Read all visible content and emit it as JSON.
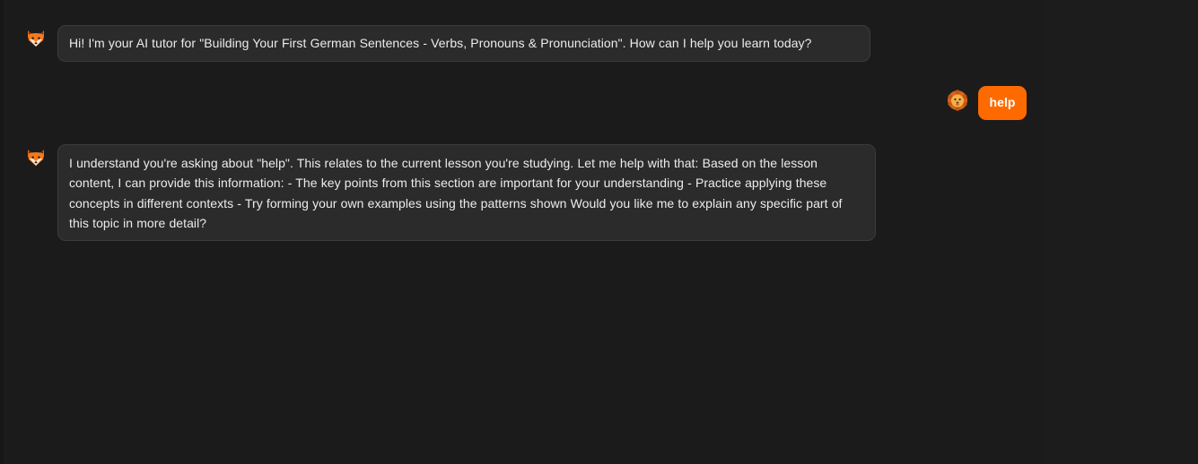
{
  "messages": [
    {
      "role": "assistant",
      "avatar": "fox-icon",
      "text": "Hi! I'm your AI tutor for \"Building Your First German Sentences - Verbs, Pronouns & Pronunciation\". How can I help you learn today?"
    },
    {
      "role": "user",
      "avatar": "lion-icon",
      "text": "help"
    },
    {
      "role": "assistant",
      "avatar": "fox-icon",
      "text": "I understand you're asking about \"help\". This relates to the current lesson you're studying. Let me help with that: Based on the lesson content, I can provide this information: - The key points from this section are important for your understanding - Practice applying these concepts in different contexts - Try forming your own examples using the patterns shown Would you like me to explain any specific part of this topic in more detail?"
    }
  ],
  "colors": {
    "background": "#1b1b1b",
    "assistant_bubble": "#2b2b2b",
    "assistant_border": "#3b3b3b",
    "user_bubble": "#ff6a00",
    "text": "#ececec"
  }
}
